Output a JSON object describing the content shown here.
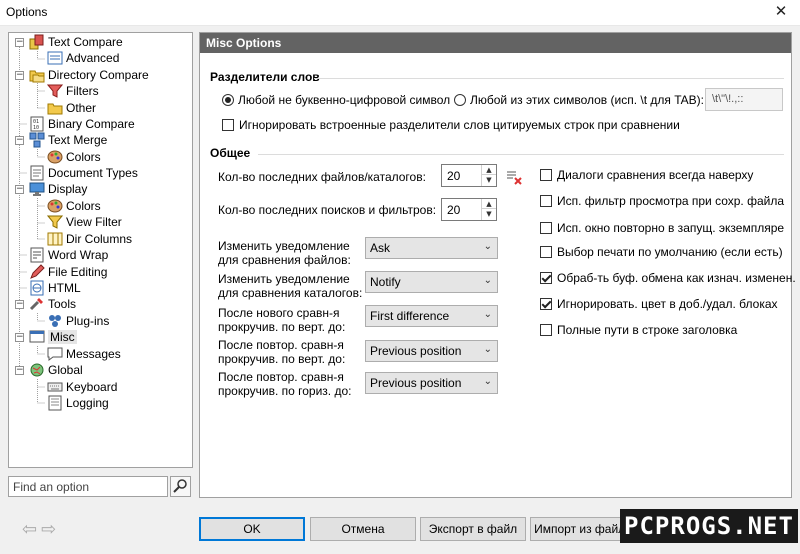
{
  "window": {
    "title": "Options",
    "close_glyph": "✕"
  },
  "tree": {
    "items": [
      {
        "label": "Text Compare",
        "icon": "text-compare-icon"
      },
      {
        "label": "Advanced",
        "icon": "advanced-icon"
      },
      {
        "label": "Directory Compare",
        "icon": "folder-compare-icon"
      },
      {
        "label": "Filters",
        "icon": "filter-icon"
      },
      {
        "label": "Other",
        "icon": "folder-icon"
      },
      {
        "label": "Binary Compare",
        "icon": "binary-icon"
      },
      {
        "label": "Text Merge",
        "icon": "merge-icon"
      },
      {
        "label": "Colors",
        "icon": "palette-icon"
      },
      {
        "label": "Document Types",
        "icon": "document-icon"
      },
      {
        "label": "Display",
        "icon": "monitor-icon"
      },
      {
        "label": "Colors",
        "icon": "palette-icon"
      },
      {
        "label": "View Filter",
        "icon": "filter-icon"
      },
      {
        "label": "Dir Columns",
        "icon": "columns-icon"
      },
      {
        "label": "Word Wrap",
        "icon": "word-wrap-icon"
      },
      {
        "label": "File Editing",
        "icon": "pencil-icon"
      },
      {
        "label": "HTML",
        "icon": "html-icon"
      },
      {
        "label": "Tools",
        "icon": "tools-icon"
      },
      {
        "label": "Plug-ins",
        "icon": "plugin-icon"
      },
      {
        "label": "Misc",
        "icon": "misc-icon"
      },
      {
        "label": "Messages",
        "icon": "message-icon"
      },
      {
        "label": "Global",
        "icon": "globe-icon"
      },
      {
        "label": "Keyboard",
        "icon": "keyboard-icon"
      },
      {
        "label": "Logging",
        "icon": "log-icon"
      }
    ],
    "expand_glyph": "−"
  },
  "search": {
    "placeholder": "Find an option",
    "icon": "search-icon"
  },
  "panel": {
    "header": "Misc Options",
    "separators": {
      "title": "Разделители слов",
      "radio_any": "Любой не буквенно-цифровой символ",
      "radio_these": "Любой из этих символов (исп. \\t для TAB):",
      "chars_value": "\\t\\\"\\!.,::",
      "ignore_label": "Игнорировать встроенные разделители слов цитируемых строк при сравнении"
    },
    "general": {
      "title": "Общее",
      "recent_files_label": "Кол-во последних файлов/каталогов:",
      "recent_files_value": "20",
      "recent_searches_label": "Кол-во последних поисков и фильтров:",
      "recent_searches_value": "20",
      "notify_files_label": "Изменить уведомление для сравнения файлов:",
      "notify_files_value": "Ask",
      "notify_dirs_label": "Изменить уведомление для сравнения каталогов:",
      "notify_dirs_value": "Notify",
      "scroll_new_label": "После нового сравн-я прокручив. по верт. до:",
      "scroll_new_value": "First difference",
      "scroll_repeat_v_label": "После повтор. сравн-я прокручив. по верт. до:",
      "scroll_repeat_v_value": "Previous position",
      "scroll_repeat_h_label": "После повтор. сравн-я прокручив. по гориз. до:",
      "scroll_repeat_h_value": "Previous position",
      "checks": [
        {
          "label": "Диалоги сравнения всегда наверху",
          "checked": false
        },
        {
          "label": "Исп. фильтр просмотра при сохр. файла",
          "checked": false
        },
        {
          "label": "Исп. окно повторно в запущ. экземпляре",
          "checked": false
        },
        {
          "label": "Выбор печати по умолчанию (если есть)",
          "checked": false
        },
        {
          "label": "Обраб-ть буф. обмена как изнач. изменен.",
          "checked": true
        },
        {
          "label": "Игнорировать. цвет в доб./удал. блоках",
          "checked": true
        },
        {
          "label": "Полные пути в строке заголовка",
          "checked": false
        }
      ]
    }
  },
  "buttons": {
    "ok": "OK",
    "cancel": "Отмена",
    "export": "Экспорт в файл",
    "import": "Импорт из файла"
  },
  "watermark": "PCPROGS.NET",
  "colors": {
    "header_bg": "#636363",
    "accent": "#0078d7"
  }
}
